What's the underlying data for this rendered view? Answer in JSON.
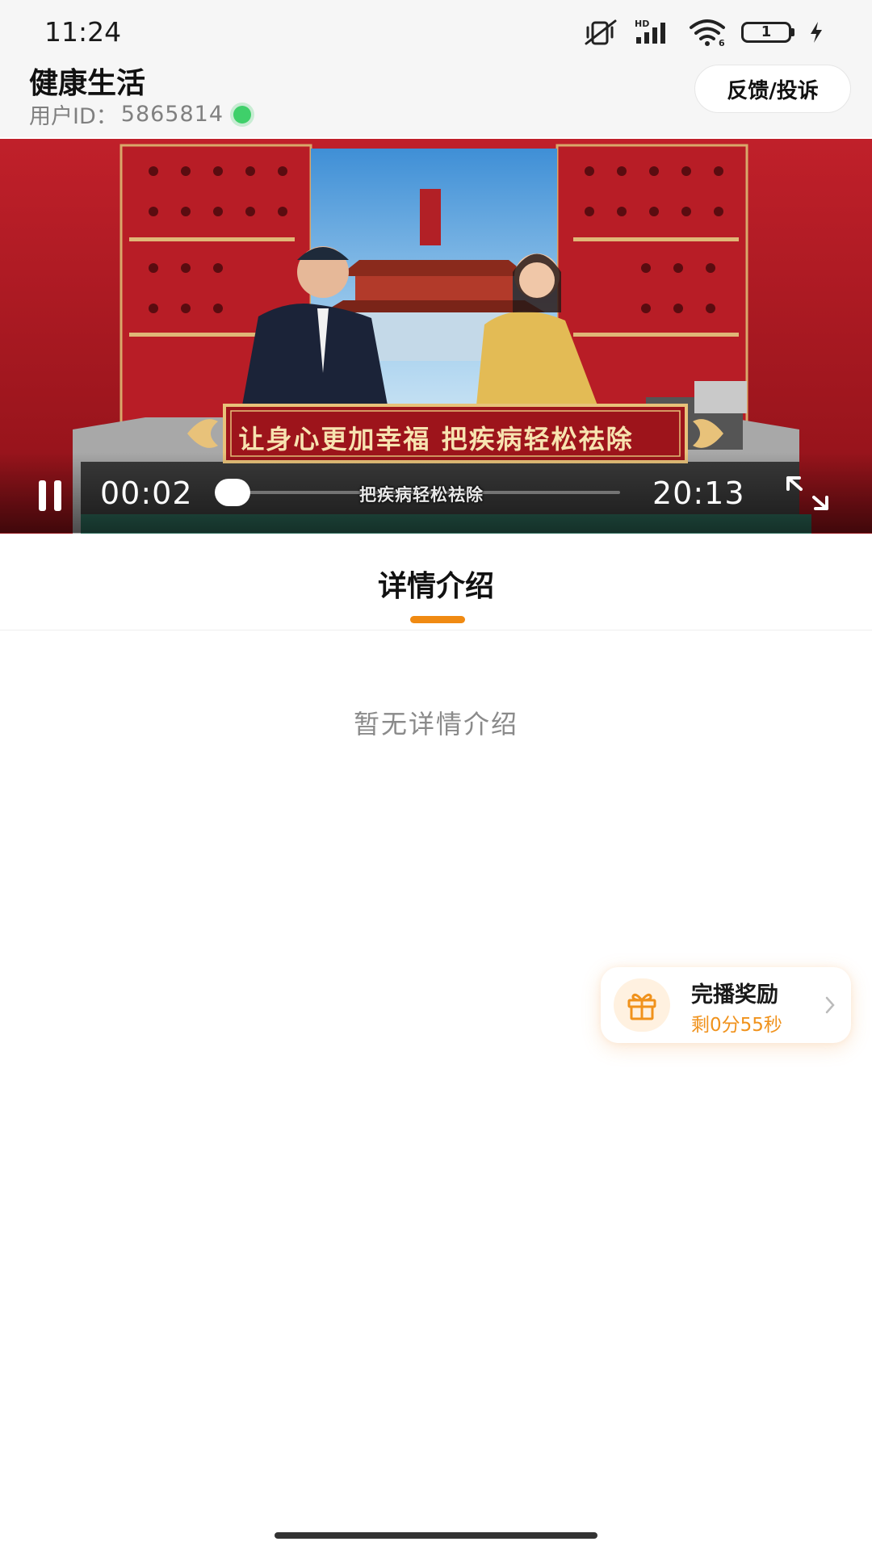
{
  "status_bar": {
    "time": "11:24",
    "network_label": "HD",
    "wifi_badge": "6",
    "battery_level": "1",
    "icons": [
      "mute-vibrate-icon",
      "signal-icon",
      "wifi-icon",
      "battery-icon",
      "charging-icon"
    ]
  },
  "header": {
    "title": "健康生活",
    "user_id_label": "用户ID：",
    "user_id_value": "5865814",
    "feedback_label": "反馈/投诉"
  },
  "video": {
    "banner_text": "让身心更加幸福 把疾病轻松祛除",
    "subtitle": "把疾病轻松祛除",
    "current_time": "00:02",
    "total_time": "20:13",
    "progress": 0.002,
    "state": "playing"
  },
  "tabs": [
    {
      "label": "详情介绍",
      "active": true
    }
  ],
  "content": {
    "empty_text": "暂无详情介绍"
  },
  "reward": {
    "title": "完播奖励",
    "remaining": "剩0分55秒"
  },
  "colors": {
    "accent": "#f08a12",
    "online": "#3fd06a",
    "video_red": "#b21a22"
  }
}
